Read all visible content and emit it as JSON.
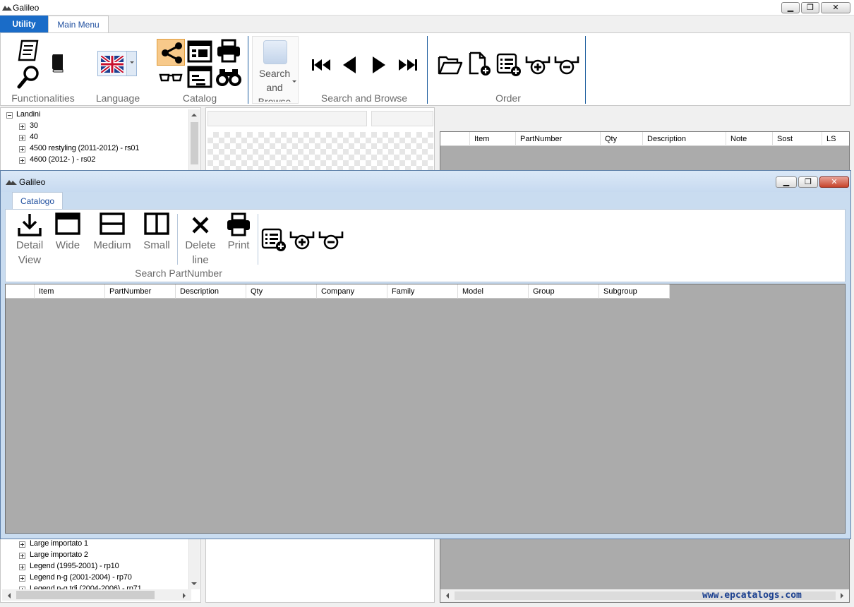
{
  "window": {
    "title": "Galileo"
  },
  "tabs": {
    "utility": "Utility",
    "main_menu": "Main Menu"
  },
  "ribbon": {
    "groups": {
      "functionalities": "Functionalities",
      "language": "Language",
      "catalog": "Catalog",
      "search_and_browse": "Search and Browse",
      "order": "Order"
    },
    "search_browse_button": {
      "line1": "Search",
      "line2": "and",
      "line3": "Browse"
    }
  },
  "tree": {
    "top_items": [
      {
        "label": "Landini"
      },
      {
        "label": "30"
      },
      {
        "label": "40"
      },
      {
        "label": "4500 restyling (2011-2012) - rs01"
      },
      {
        "label": "4600 (2012-     ) - rs02"
      }
    ],
    "bottom_items": [
      {
        "label": "Large importato 1"
      },
      {
        "label": "Large importato 2"
      },
      {
        "label": "Legend (1995-2001) - rp10"
      },
      {
        "label": "Legend n-g (2001-2004) - rp70"
      },
      {
        "label": "Legend n-g tdi (2004-2006) - rp71"
      }
    ]
  },
  "order_grid": {
    "columns": [
      "Item",
      "PartNumber",
      "Qty",
      "Description",
      "Note",
      "Sost",
      "LS"
    ]
  },
  "watermark": "www.epcatalogs.com",
  "dialog": {
    "title": "Galileo",
    "tab": "Catalogo",
    "buttons": {
      "detail_view": {
        "line1": "Detail",
        "line2": "View"
      },
      "wide": "Wide",
      "medium": "Medium",
      "small": "Small",
      "delete_line": {
        "line1": "Delete",
        "line2": "line"
      },
      "print": "Print"
    },
    "group_label": "Search PartNumber",
    "grid_columns": [
      "Item",
      "PartNumber",
      "Description",
      "Qty",
      "Company",
      "Family",
      "Model",
      "Group",
      "Subgroup"
    ]
  },
  "icons": {
    "app": "galileo-logo-icon",
    "accent": "#1a6cc8"
  }
}
